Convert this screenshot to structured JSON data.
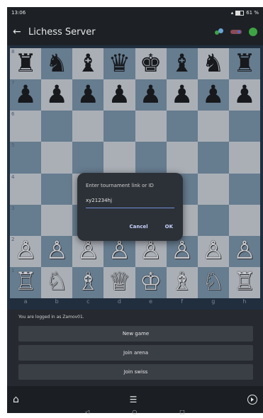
{
  "status": {
    "time": "13:06",
    "battery": "61 %"
  },
  "appbar": {
    "title": "Lichess Server"
  },
  "board": {
    "ranks": [
      "8",
      "7",
      "6",
      "5",
      "4",
      "3",
      "2",
      "1"
    ],
    "files": [
      "a",
      "b",
      "c",
      "d",
      "e",
      "f",
      "g",
      "h"
    ],
    "pieces": {
      "8": [
        "♜",
        "♞",
        "♝",
        "♛",
        "♚",
        "♝",
        "♞",
        "♜"
      ],
      "7": [
        "♟",
        "♟",
        "♟",
        "♟",
        "♟",
        "♟",
        "♟",
        "♟"
      ],
      "2": [
        "♙",
        "♙",
        "♙",
        "♙",
        "♙",
        "♙",
        "♙",
        "♙"
      ],
      "1": [
        "♖",
        "♘",
        "♗",
        "♕",
        "♔",
        "♗",
        "♘",
        "♖"
      ]
    },
    "colors": {
      "light": "#d9dde0",
      "dark": "#7e98ad"
    }
  },
  "dialog": {
    "title": "Enter tournament link or ID",
    "input_value": "xy21234hj",
    "cancel": "Cancel",
    "ok": "OK"
  },
  "panel": {
    "logged_in_text": "You are logged in as Zamov01.",
    "buttons": [
      "New game",
      "Join arena",
      "Join swiss"
    ]
  },
  "bottombar": {
    "home_icon": "home-icon",
    "list_icon": "list-icon",
    "play_icon": "play-circle-icon"
  },
  "nav": [
    "◁",
    "○",
    "□"
  ]
}
